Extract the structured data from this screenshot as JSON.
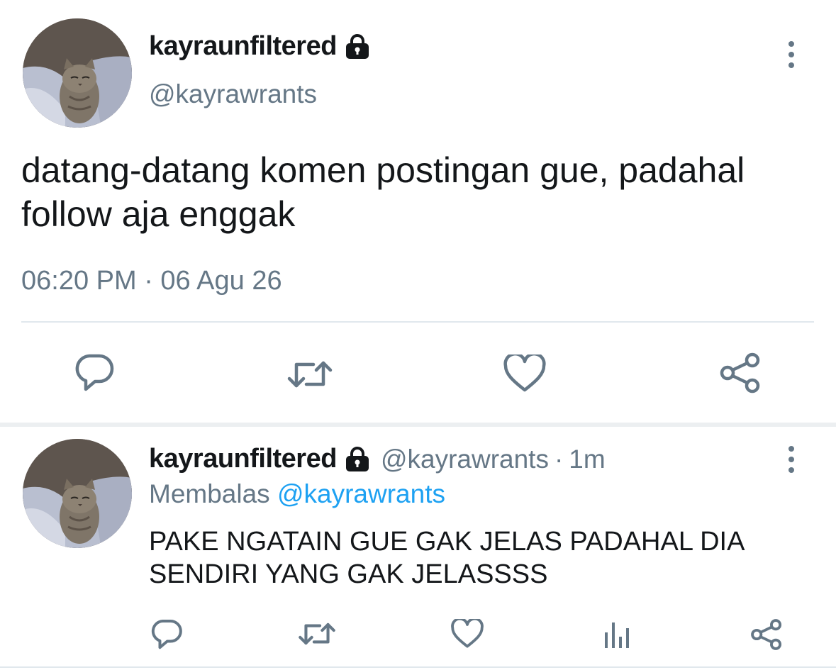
{
  "main_tweet": {
    "display_name": "kayraunfiltered",
    "handle": "@kayrawrants",
    "lock_icon": "lock-icon",
    "text": "datang-datang komen postingan gue, padahal follow aja enggak",
    "timestamp": "06:20 PM · 06 Agu 26",
    "actions": [
      "reply-icon",
      "retweet-icon",
      "like-icon",
      "share-icon"
    ]
  },
  "reply_tweet": {
    "display_name": "kayraunfiltered",
    "handle": "@kayrawrants",
    "time_sep": "·",
    "time": "1m",
    "replying_label": "Membalas",
    "replying_to": "@kayrawrants",
    "text": "PAKE NGATAIN GUE GAK JELAS PADAHAL DIA SENDIRI YANG GAK JELASSSS",
    "actions": [
      "reply-icon",
      "retweet-icon",
      "like-icon",
      "analytics-icon",
      "share-icon"
    ]
  },
  "colors": {
    "text": "#14171a",
    "secondary": "#657786",
    "link": "#1da1f2",
    "divider": "#e1e8ed"
  }
}
